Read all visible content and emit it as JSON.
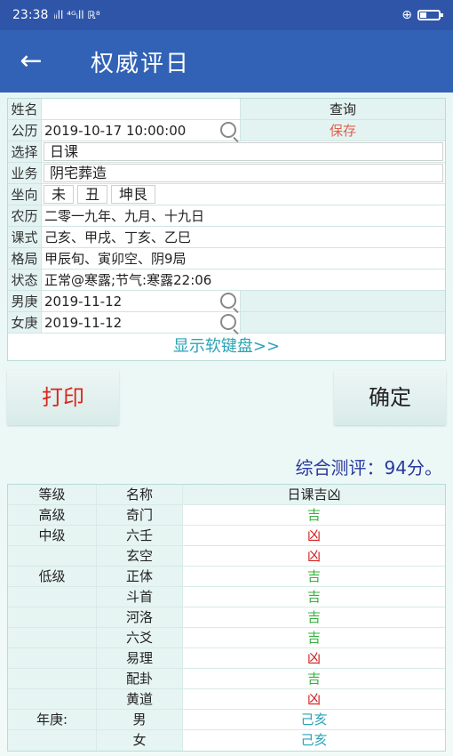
{
  "status": {
    "time": "23:38",
    "signal": "ᵢᵢll ⁴ᴳᵢll ℝ⁸",
    "battery_level": 0.3
  },
  "appbar": {
    "back": "←",
    "title": "权威评日"
  },
  "form": {
    "name_label": "姓名",
    "name_value": "",
    "query": "查询",
    "date_label": "公历",
    "date_value": "2019-10-17  10:00:00",
    "save": "保存",
    "select_label": "选择",
    "select_value": "日课",
    "business_label": "业务",
    "business_value": "阴宅葬造",
    "direction_label": "坐向",
    "dir": [
      "未",
      "丑",
      "坤艮"
    ],
    "lunar_label": "农历",
    "lunar_value": "二零一九年、九月、十九日",
    "ganzhi_label": "课式",
    "ganzhi_value": "己亥、甲戌、丁亥、乙巳",
    "pattern_label": "格局",
    "pattern_value": "甲辰旬、寅卯空、阴9局",
    "state_label": "状态",
    "state_value": "正常@寒露;节气:寒露22:06",
    "male_label": "男庚",
    "male_value": "2019-11-12",
    "female_label": "女庚",
    "female_value": "2019-11-12",
    "keyboard": "显示软键盘>>"
  },
  "buttons": {
    "print": "打印",
    "ok": "确定"
  },
  "score": "综合测评：94分。",
  "table": {
    "h1": "等级",
    "h2": "名称",
    "h3": "日课吉凶",
    "rows": [
      {
        "level": "高级",
        "name": "奇门",
        "result": "吉"
      },
      {
        "level": "中级",
        "name": "六壬",
        "result": "凶"
      },
      {
        "level": "",
        "name": "玄空",
        "result": "凶"
      },
      {
        "level": "低级",
        "name": "正体",
        "result": "吉"
      },
      {
        "level": "",
        "name": "斗首",
        "result": "吉"
      },
      {
        "level": "",
        "name": "河洛",
        "result": "吉"
      },
      {
        "level": "",
        "name": "六爻",
        "result": "吉"
      },
      {
        "level": "",
        "name": "易理",
        "result": "凶"
      },
      {
        "level": "",
        "name": "配卦",
        "result": "吉"
      },
      {
        "level": "",
        "name": "黄道",
        "result": "凶"
      },
      {
        "level": "年庚:",
        "name": "男",
        "result": "己亥"
      },
      {
        "level": "",
        "name": "女",
        "result": "己亥"
      }
    ]
  }
}
